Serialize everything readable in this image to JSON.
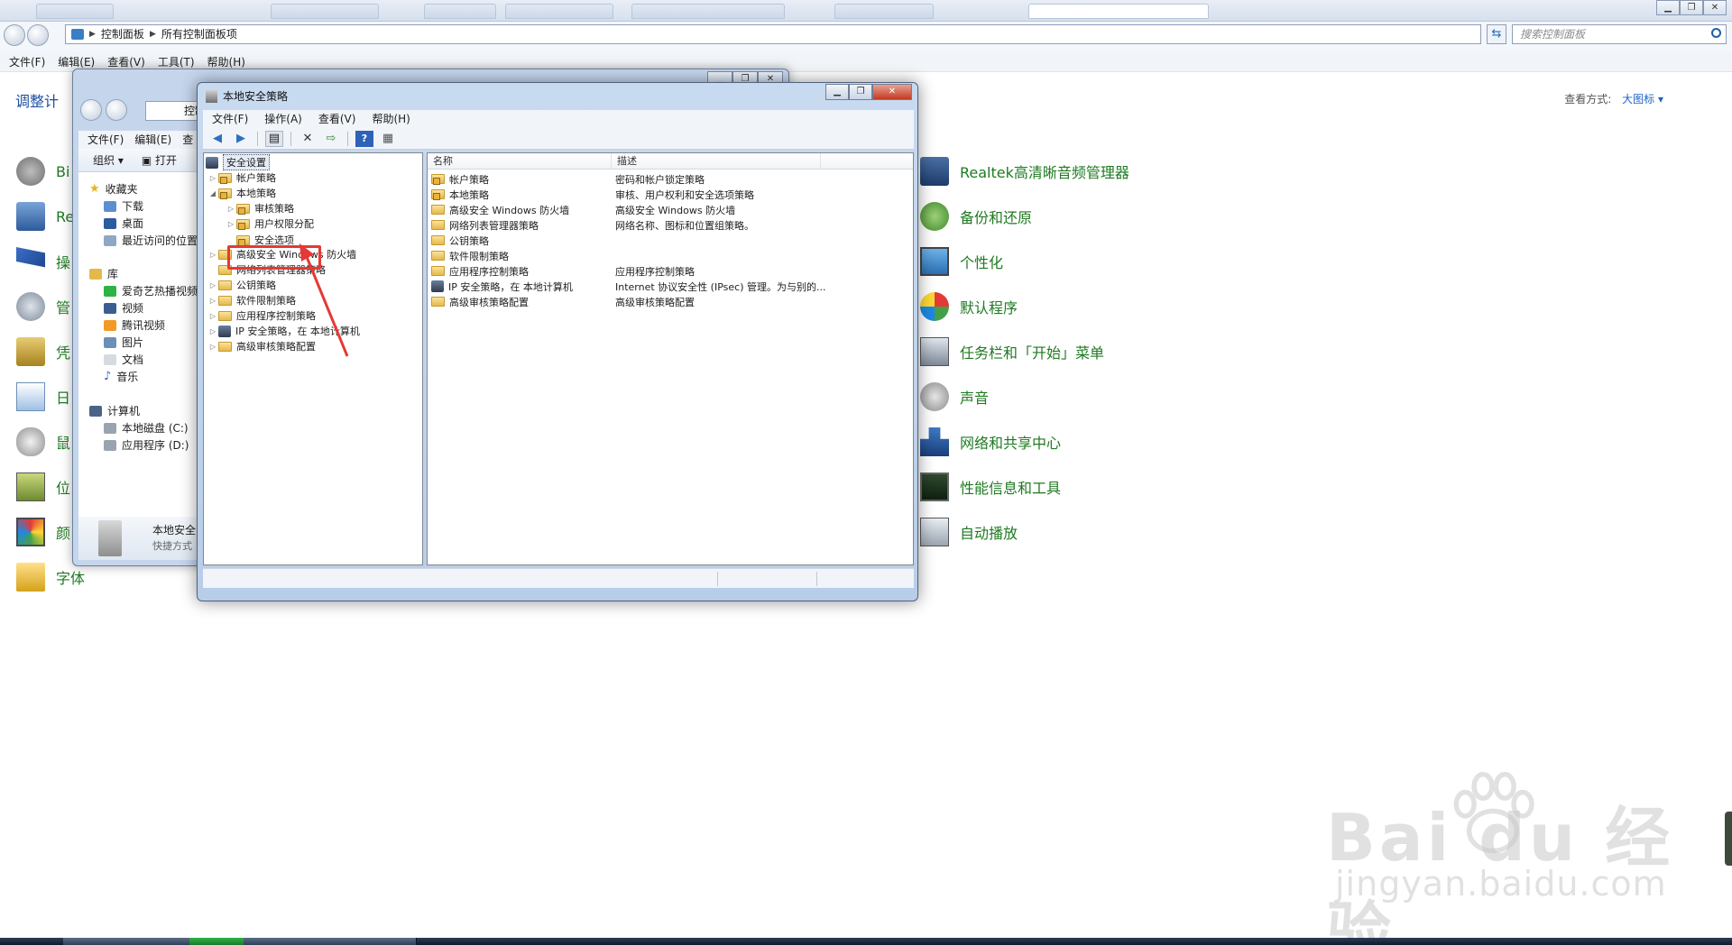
{
  "control_panel": {
    "breadcrumb": [
      "控制面板",
      "所有控制面板项"
    ],
    "search_placeholder": "搜索控制面板",
    "menu": [
      "文件(F)",
      "编辑(E)",
      "查看(V)",
      "工具(T)",
      "帮助(H)"
    ],
    "header_title": "调整计",
    "view_by_label": "查看方式:",
    "view_by_value": "大图标",
    "left_items": [
      "Bi",
      "Re",
      "操",
      "管",
      "凭",
      "日",
      "鼠",
      "位",
      "颜",
      "字体"
    ],
    "right_items": [
      "Realtek高清晰音频管理器",
      "备份和还原",
      "个性化",
      "默认程序",
      "任务栏和「开始」菜单",
      "声音",
      "网络和共享中心",
      "性能信息和工具",
      "自动播放"
    ]
  },
  "explorer": {
    "address_text": "控制",
    "menu": [
      "文件(F)",
      "编辑(E)",
      "查"
    ],
    "toolbar": [
      "组织",
      "打开"
    ],
    "nav": {
      "favorites_header": "收藏夹",
      "favorites": [
        "下载",
        "桌面",
        "最近访问的位置"
      ],
      "library_header": "库",
      "library": [
        "爱奇艺热播视频",
        "视频",
        "腾讯视频",
        "图片",
        "文档",
        "音乐"
      ],
      "computer_header": "计算机",
      "computer": [
        "本地磁盘 (C:)",
        "应用程序 (D:)"
      ]
    },
    "details": {
      "name": "本地安全",
      "type": "快捷方式"
    }
  },
  "lsp": {
    "title": "本地安全策略",
    "menu": [
      "文件(F)",
      "操作(A)",
      "查看(V)",
      "帮助(H)"
    ],
    "tree": {
      "root": "安全设置",
      "account_policy": "帐户策略",
      "local_policy": "本地策略",
      "audit_policy": "审核策略",
      "user_rights": "用户权限分配",
      "security_options": "安全选项",
      "firewall": "高级安全 Windows 防火墙",
      "network_list": "网络列表管理器策略",
      "public_key": "公钥策略",
      "software_restriction": "软件限制策略",
      "app_control": "应用程序控制策略",
      "ipsec": "IP 安全策略，在 本地计算机",
      "advanced_audit": "高级审核策略配置"
    },
    "columns": {
      "name": "名称",
      "description": "描述"
    },
    "rows": [
      {
        "name": "帐户策略",
        "desc": "密码和帐户锁定策略"
      },
      {
        "name": "本地策略",
        "desc": "审核、用户权利和安全选项策略"
      },
      {
        "name": "高级安全 Windows 防火墙",
        "desc": "高级安全 Windows 防火墙"
      },
      {
        "name": "网络列表管理器策略",
        "desc": "网络名称、图标和位置组策略。"
      },
      {
        "name": "公钥策略",
        "desc": ""
      },
      {
        "name": "软件限制策略",
        "desc": ""
      },
      {
        "name": "应用程序控制策略",
        "desc": "应用程序控制策略"
      },
      {
        "name": "IP 安全策略，在 本地计算机",
        "desc": "Internet 协议安全性 (IPsec) 管理。为与别的..."
      },
      {
        "name": "高级审核策略配置",
        "desc": "高级审核策略配置"
      }
    ]
  },
  "watermark": {
    "main": "Bai du 经验",
    "sub": "jingyan.baidu.com"
  },
  "colors": {
    "cp_link": "#1e7a20",
    "highlight": "#e53935",
    "title_blue": "#1e4fa0"
  }
}
